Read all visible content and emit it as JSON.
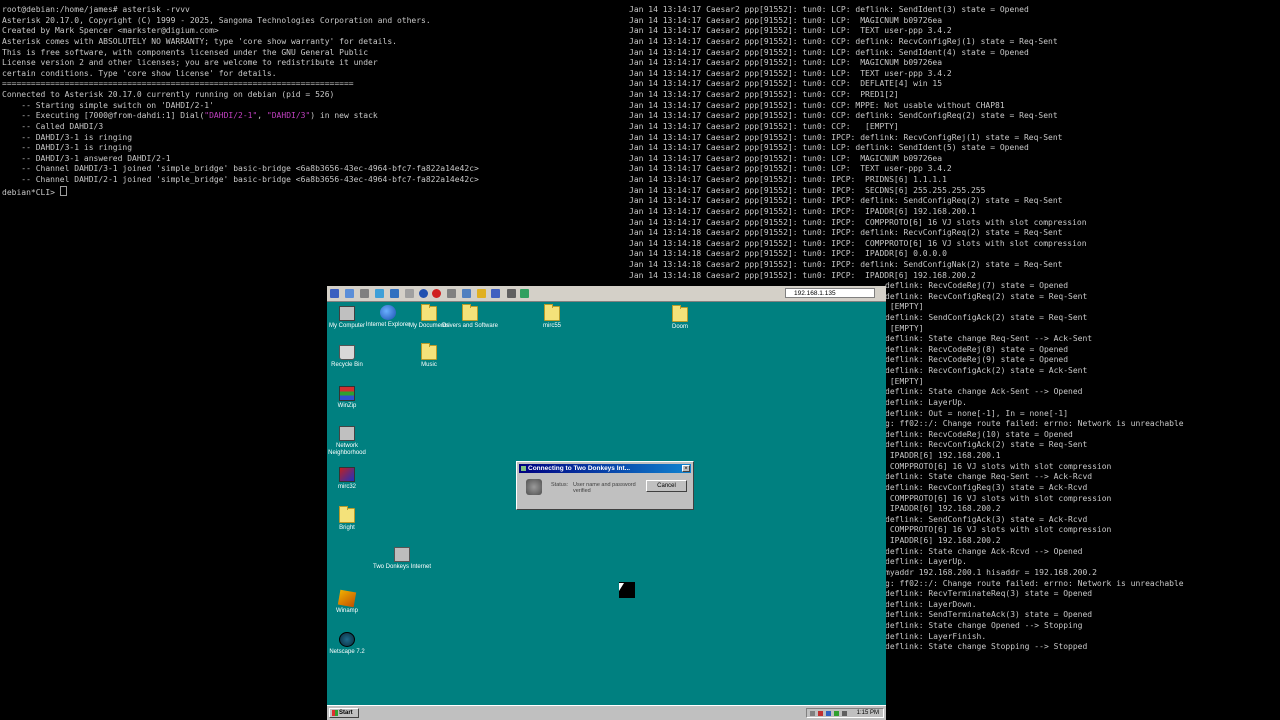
{
  "terminal_left": {
    "lines": [
      "root@debian:/home/james# asterisk -rvvv",
      "Asterisk 20.17.0, Copyright (C) 1999 - 2025, Sangoma Technologies Corporation and others.",
      "Created by Mark Spencer <markster@digium.com>",
      "Asterisk comes with ABSOLUTELY NO WARRANTY; type 'core show warranty' for details.",
      "This is free software, with components licensed under the GNU General Public",
      "License version 2 and other licenses; you are welcome to redistribute it under",
      "certain conditions. Type 'core show license' for details.",
      "=========================================================================",
      "Connected to Asterisk 20.17.0 currently running on debian (pid = 526)",
      "    -- Starting simple switch on 'DAHDI/2-1'",
      "    -- Executing [7000@from-dahdi:1] Dial(\"DAHDI/2-1\", \"DAHDI/3\") in new stack",
      "    -- Called DAHDI/3",
      "    -- DAHDI/3-1 is ringing",
      "    -- DAHDI/3-1 is ringing",
      "    -- DAHDI/3-1 answered DAHDI/2-1",
      "    -- Channel DAHDI/3-1 joined 'simple_bridge' basic-bridge <6a8b3656-43ec-4964-bfc7-fa822a14e42c>",
      "    -- Channel DAHDI/2-1 joined 'simple_bridge' basic-bridge <6a8b3656-43ec-4964-bfc7-fa822a14e42c>",
      "debian*CLI> "
    ]
  },
  "terminal_right": {
    "lines": [
      "Jan 14 13:14:17 Caesar2 ppp[91552]: tun0: LCP: deflink: SendIdent(3) state = Opened",
      "Jan 14 13:14:17 Caesar2 ppp[91552]: tun0: LCP:  MAGICNUM b09726ea",
      "Jan 14 13:14:17 Caesar2 ppp[91552]: tun0: LCP:  TEXT user-ppp 3.4.2",
      "Jan 14 13:14:17 Caesar2 ppp[91552]: tun0: CCP: deflink: RecvConfigRej(1) state = Req-Sent",
      "Jan 14 13:14:17 Caesar2 ppp[91552]: tun0: LCP: deflink: SendIdent(4) state = Opened",
      "Jan 14 13:14:17 Caesar2 ppp[91552]: tun0: LCP:  MAGICNUM b09726ea",
      "Jan 14 13:14:17 Caesar2 ppp[91552]: tun0: LCP:  TEXT user-ppp 3.4.2",
      "Jan 14 13:14:17 Caesar2 ppp[91552]: tun0: CCP:  DEFLATE[4] win 15",
      "Jan 14 13:14:17 Caesar2 ppp[91552]: tun0: CCP:  PRED1[2]",
      "Jan 14 13:14:17 Caesar2 ppp[91552]: tun0: CCP: MPPE: Not usable without CHAP81",
      "Jan 14 13:14:17 Caesar2 ppp[91552]: tun0: CCP: deflink: SendConfigReq(2) state = Req-Sent",
      "Jan 14 13:14:17 Caesar2 ppp[91552]: tun0: CCP:   [EMPTY]",
      "Jan 14 13:14:17 Caesar2 ppp[91552]: tun0: IPCP: deflink: RecvConfigRej(1) state = Req-Sent",
      "Jan 14 13:14:17 Caesar2 ppp[91552]: tun0: LCP: deflink: SendIdent(5) state = Opened",
      "Jan 14 13:14:17 Caesar2 ppp[91552]: tun0: LCP:  MAGICNUM b09726ea",
      "Jan 14 13:14:17 Caesar2 ppp[91552]: tun0: LCP:  TEXT user-ppp 3.4.2",
      "Jan 14 13:14:17 Caesar2 ppp[91552]: tun0: IPCP:  PRIDNS[6] 1.1.1.1",
      "Jan 14 13:14:17 Caesar2 ppp[91552]: tun0: IPCP:  SECDNS[6] 255.255.255.255",
      "Jan 14 13:14:17 Caesar2 ppp[91552]: tun0: IPCP: deflink: SendConfigReq(2) state = Req-Sent",
      "Jan 14 13:14:17 Caesar2 ppp[91552]: tun0: IPCP:  IPADDR[6] 192.168.200.1",
      "Jan 14 13:14:17 Caesar2 ppp[91552]: tun0: IPCP:  COMPPROTO[6] 16 VJ slots with slot compression",
      "Jan 14 13:14:18 Caesar2 ppp[91552]: tun0: IPCP: deflink: RecvConfigReq(2) state = Req-Sent",
      "Jan 14 13:14:18 Caesar2 ppp[91552]: tun0: IPCP:  COMPPROTO[6] 16 VJ slots with slot compression",
      "Jan 14 13:14:18 Caesar2 ppp[91552]: tun0: IPCP:  IPADDR[6] 0.0.0.0",
      "Jan 14 13:14:18 Caesar2 ppp[91552]: tun0: IPCP: deflink: SendConfigNak(2) state = Req-Sent",
      "Jan 14 13:14:18 Caesar2 ppp[91552]: tun0: IPCP:  IPADDR[6] 192.168.200.2"
    ],
    "overflow_lines": [
      "deflink: RecvCodeRej(7) state = Opened",
      "deflink: RecvConfigReq(2) state = Req-Sent",
      " [EMPTY]",
      "deflink: SendConfigAck(2) state = Req-Sent",
      " [EMPTY]",
      "deflink: State change Req-Sent --> Ack-Sent",
      "deflink: RecvCodeRej(8) state = Opened",
      "deflink: RecvCodeRej(9) state = Opened",
      "deflink: RecvConfigAck(2) state = Ack-Sent",
      " [EMPTY]",
      "deflink: State change Ack-Sent --> Opened",
      "deflink: LayerUp.",
      "deflink: Out = none[-1], In = none[-1]",
      "g: ff02::/: Change route failed: errno: Network is unreachable",
      "deflink: RecvCodeRej(10) state = Opened",
      "deflink: RecvConfigAck(2) state = Req-Sent",
      " IPADDR[6] 192.168.200.1",
      " COMPPROTO[6] 16 VJ slots with slot compression",
      "deflink: State change Req-Sent --> Ack-Rcvd",
      "deflink: RecvConfigReq(3) state = Ack-Rcvd",
      " COMPPROTO[6] 16 VJ slots with slot compression",
      " IPADDR[6] 192.168.200.2",
      "deflink: SendConfigAck(3) state = Ack-Rcvd",
      " COMPPROTO[6] 16 VJ slots with slot compression",
      " IPADDR[6] 192.168.200.2",
      "deflink: State change Ack-Rcvd --> Opened",
      "deflink: LayerUp.",
      "myaddr 192.168.200.1 hisaddr = 192.168.200.2",
      "g: ff02::/: Change route failed: errno: Network is unreachable",
      "deflink: RecvTerminateReq(3) state = Opened",
      "deflink: LayerDown.",
      "deflink: SendTerminateAck(3) state = Opened",
      "deflink: State change Opened --> Stopping",
      "deflink: LayerFinish.",
      "deflink: State change Stopping --> Stopped"
    ]
  },
  "rdp": {
    "address": "192.168.1.135",
    "desktop_icons": [
      {
        "id": "my-computer",
        "label": "My Computer",
        "kind": "pc"
      },
      {
        "id": "internet-explorer",
        "label": "Internet Explorer",
        "kind": "globe"
      },
      {
        "id": "my-documents",
        "label": "My Documents",
        "kind": "folder"
      },
      {
        "id": "drivers-and-software",
        "label": "Drivers and Software",
        "kind": "folder"
      },
      {
        "id": "mirc55",
        "label": "mirc55",
        "kind": "folder"
      },
      {
        "id": "doom",
        "label": "Doom",
        "kind": "folder"
      },
      {
        "id": "recycle-bin",
        "label": "Recycle Bin",
        "kind": "bin"
      },
      {
        "id": "music",
        "label": "Music",
        "kind": "folder"
      },
      {
        "id": "winzip",
        "label": "WinZip",
        "kind": "zip"
      },
      {
        "id": "network-neighborhood",
        "label": "Network Neighborhood",
        "kind": "net"
      },
      {
        "id": "mirc32",
        "label": "mirc32",
        "kind": "mirc"
      },
      {
        "id": "bright",
        "label": "Bright",
        "kind": "folder"
      },
      {
        "id": "two-donkeys-internet",
        "label": "Two Donkeys Internet",
        "kind": "donkey"
      },
      {
        "id": "winamp",
        "label": "Winamp",
        "kind": "winamp"
      },
      {
        "id": "netscape",
        "label": "Netscape 7.2",
        "kind": "netscape"
      }
    ],
    "dialog": {
      "title": "Connecting to Two Donkeys Int...",
      "status_label": "Status:",
      "status_text": "User name and password verified",
      "cancel_label": "Cancel",
      "close_glyph": "×"
    },
    "taskbar": {
      "start_label": "Start",
      "clock": "1:15 PM"
    }
  }
}
